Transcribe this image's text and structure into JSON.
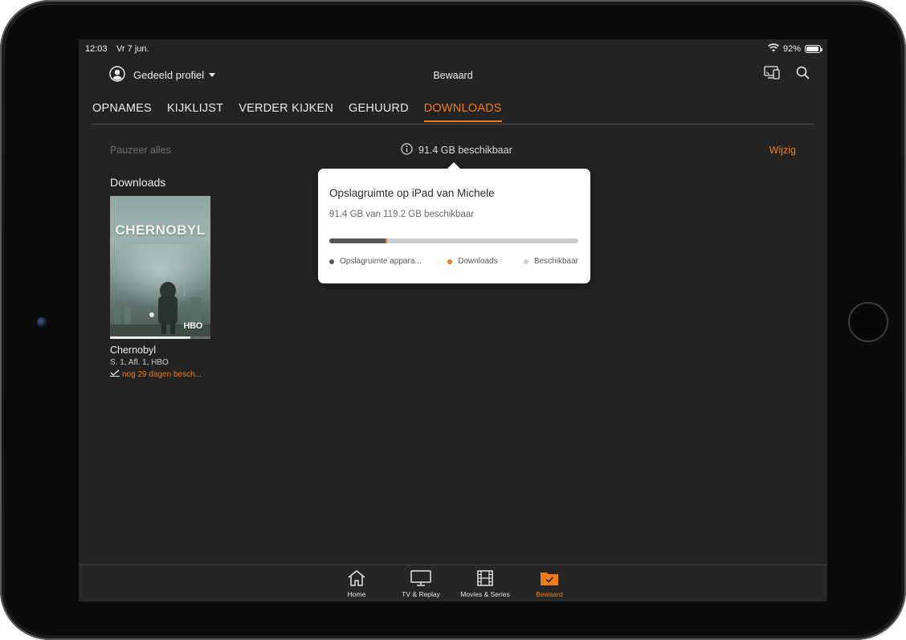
{
  "status_bar": {
    "time": "12:03",
    "date": "Vr 7 jun.",
    "battery": "92%",
    "battery_level": 0.92
  },
  "header": {
    "profile_label": "Gedeeld profiel",
    "title": "Bewaard",
    "icons": [
      "user-circle-icon",
      "cast-device-icon",
      "search-icon"
    ]
  },
  "tabs": [
    {
      "label": "OPNAMES",
      "active": false
    },
    {
      "label": "KIJKLIJST",
      "active": false
    },
    {
      "label": "VERDER KIJKEN",
      "active": false
    },
    {
      "label": "GEHUURD",
      "active": false
    },
    {
      "label": "DOWNLOADS",
      "active": true
    }
  ],
  "toolbar": {
    "pause_all": "Pauzeer alles",
    "available": "91.4 GB beschikbaar",
    "edit": "Wijzig"
  },
  "downloads": {
    "section_title": "Downloads",
    "items": [
      {
        "poster_title": "CHERNOBYL",
        "poster_network": "HBO",
        "title": "Chernobyl",
        "subtitle": "S. 1, Afl. 1, HBO",
        "expiry": "nog 29 dagen besch...",
        "watch_progress": 0.8
      }
    ]
  },
  "storage_popover": {
    "title": "Opslagruimte op iPad van Michele",
    "subtitle": "91.4 GB van 119.2 GB beschikbaar",
    "device_fraction": 0.225,
    "downloads_fraction": 0.008,
    "legend": [
      {
        "label": "Opslagruimte appara...",
        "color": "#555555"
      },
      {
        "label": "Downloads",
        "color": "#f07c1a"
      },
      {
        "label": "Beschikbaar",
        "color": "#cccccc"
      }
    ]
  },
  "bottom_nav": [
    {
      "label": "Home",
      "icon": "home-icon",
      "active": false
    },
    {
      "label": "TV & Replay",
      "icon": "tv-icon",
      "active": false
    },
    {
      "label": "Movies & Series",
      "icon": "film-icon",
      "active": false
    },
    {
      "label": "Bewaard",
      "icon": "saved-folder-icon",
      "active": true
    }
  ],
  "colors": {
    "accent": "#f07c1a",
    "background": "#232323"
  }
}
